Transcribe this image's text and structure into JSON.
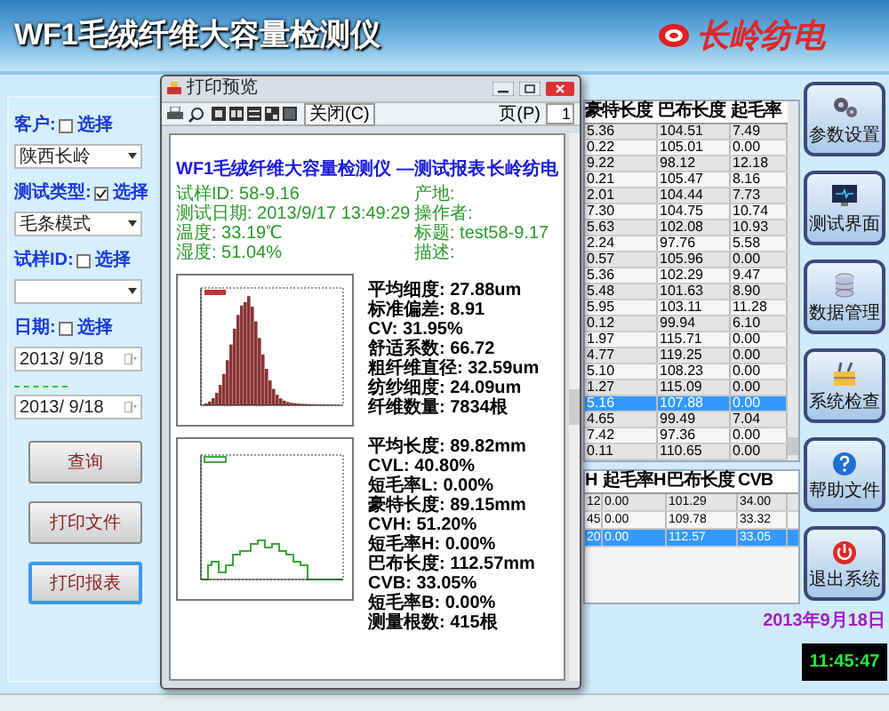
{
  "header": {
    "title": "WF1毛绒纤维大容量检测仪",
    "logo_text": "长岭纺电"
  },
  "filters": [
    {
      "label": "客户:",
      "option": "选择",
      "checked": false,
      "fields": [
        {
          "kind": "select",
          "value": "陕西长岭"
        }
      ]
    },
    {
      "label": "测试类型:",
      "option": "选择",
      "checked": true,
      "fields": [
        {
          "kind": "select",
          "value": "毛条模式"
        }
      ]
    },
    {
      "label": "试样ID:",
      "option": "选择",
      "checked": false,
      "fields": [
        {
          "kind": "select"
        }
      ]
    },
    {
      "label": "日期:",
      "option": "选择",
      "checked": false,
      "fields": [
        {
          "kind": "date",
          "value": "2013/ 9/18"
        },
        {
          "kind": "date",
          "value": "2013/ 9/18"
        }
      ]
    }
  ],
  "buttons": [
    {
      "label": "查询",
      "focused": false
    },
    {
      "label": "打印文件",
      "focused": false
    },
    {
      "label": "打印报表",
      "focused": true
    }
  ],
  "preview": {
    "title": "打印预览",
    "close_button": "关闭(C)",
    "page_label": "页(P)",
    "page": "1",
    "report": {
      "title": "WF1毛绒纤维大容量检测仪 —测试报表",
      "company": "长岭纺电",
      "info_left": [
        "试样ID: 58-9.16",
        "测试日期: 2013/9/17 13:49:29",
        "温度: 33.19℃",
        "湿度: 51.04%"
      ],
      "info_right": [
        "产地:",
        "操作者:",
        "标题: test58-9.17",
        "描述:"
      ],
      "fiber_stats": [
        "平均细度: 27.88um",
        "标准偏差: 8.91",
        "CV: 31.95%",
        "舒适系数: 66.72",
        "粗纤维直径: 32.59um",
        "纺纱细度: 24.09um",
        "纤维数量: 7834根"
      ],
      "length_stats": [
        "平均长度: 89.82mm",
        "CVL: 40.80%",
        "短毛率L: 0.00%",
        "豪特长度: 89.15mm",
        "CVH: 51.20%",
        "短毛率H: 0.00%",
        "巴布长度: 112.57mm",
        "CVB: 33.05%",
        "短毛率B: 0.00%",
        "测量根数: 415根"
      ]
    }
  },
  "results_table": {
    "columns": [
      "豪特长度",
      "巴布长度",
      "起毛率"
    ],
    "rows": [
      {
        "cells": [
          "5.36",
          "104.51",
          "7.49"
        ],
        "selected": false
      },
      {
        "cells": [
          "0.22",
          "105.01",
          "0.00"
        ],
        "selected": false
      },
      {
        "cells": [
          "9.22",
          "98.12",
          "12.18"
        ],
        "selected": false
      },
      {
        "cells": [
          "0.21",
          "105.47",
          "8.16"
        ],
        "selected": false
      },
      {
        "cells": [
          "2.01",
          "104.44",
          "7.73"
        ],
        "selected": false
      },
      {
        "cells": [
          "7.30",
          "104.75",
          "10.74"
        ],
        "selected": false
      },
      {
        "cells": [
          "5.63",
          "102.08",
          "10.93"
        ],
        "selected": false
      },
      {
        "cells": [
          "2.24",
          "97.76",
          "5.58"
        ],
        "selected": false
      },
      {
        "cells": [
          "0.57",
          "105.96",
          "0.00"
        ],
        "selected": false
      },
      {
        "cells": [
          "5.36",
          "102.29",
          "9.47"
        ],
        "selected": false
      },
      {
        "cells": [
          "5.48",
          "101.63",
          "8.90"
        ],
        "selected": false
      },
      {
        "cells": [
          "5.95",
          "103.11",
          "11.28"
        ],
        "selected": false
      },
      {
        "cells": [
          "0.12",
          "99.94",
          "6.10"
        ],
        "selected": false
      },
      {
        "cells": [
          "1.97",
          "115.71",
          "0.00"
        ],
        "selected": false
      },
      {
        "cells": [
          "4.77",
          "119.25",
          "0.00"
        ],
        "selected": false
      },
      {
        "cells": [
          "5.10",
          "108.23",
          "0.00"
        ],
        "selected": false
      },
      {
        "cells": [
          "1.27",
          "115.09",
          "0.00"
        ],
        "selected": false
      },
      {
        "cells": [
          "5.16",
          "107.88",
          "0.00"
        ],
        "selected": true
      },
      {
        "cells": [
          "4.65",
          "99.49",
          "7.04"
        ],
        "selected": false
      },
      {
        "cells": [
          "7.42",
          "97.36",
          "0.00"
        ],
        "selected": false
      },
      {
        "cells": [
          "0.11",
          "110.65",
          "0.00"
        ],
        "selected": false
      }
    ]
  },
  "summary_table": {
    "columns": [
      "H",
      "起毛率H",
      "巴布长度",
      "CVB"
    ],
    "rows": [
      {
        "cells": [
          "12",
          "0.00",
          "101.29",
          "34.00"
        ],
        "selected": false
      },
      {
        "cells": [
          "45",
          "0.00",
          "109.78",
          "33.32"
        ],
        "selected": false
      },
      {
        "cells": [
          "20",
          "0.00",
          "112.57",
          "33.05"
        ],
        "selected": true
      }
    ]
  },
  "nav_buttons": [
    {
      "label": "参数设置",
      "kind": "gears"
    },
    {
      "label": "测试界面",
      "kind": "monitor"
    },
    {
      "label": "数据管理",
      "kind": "database"
    },
    {
      "label": "系统检查",
      "kind": "toolbox"
    },
    {
      "label": "帮助文件",
      "kind": "help"
    },
    {
      "label": "退出系统",
      "kind": "power"
    }
  ],
  "date": "2013年9月18日",
  "clock": "11:45:47"
}
